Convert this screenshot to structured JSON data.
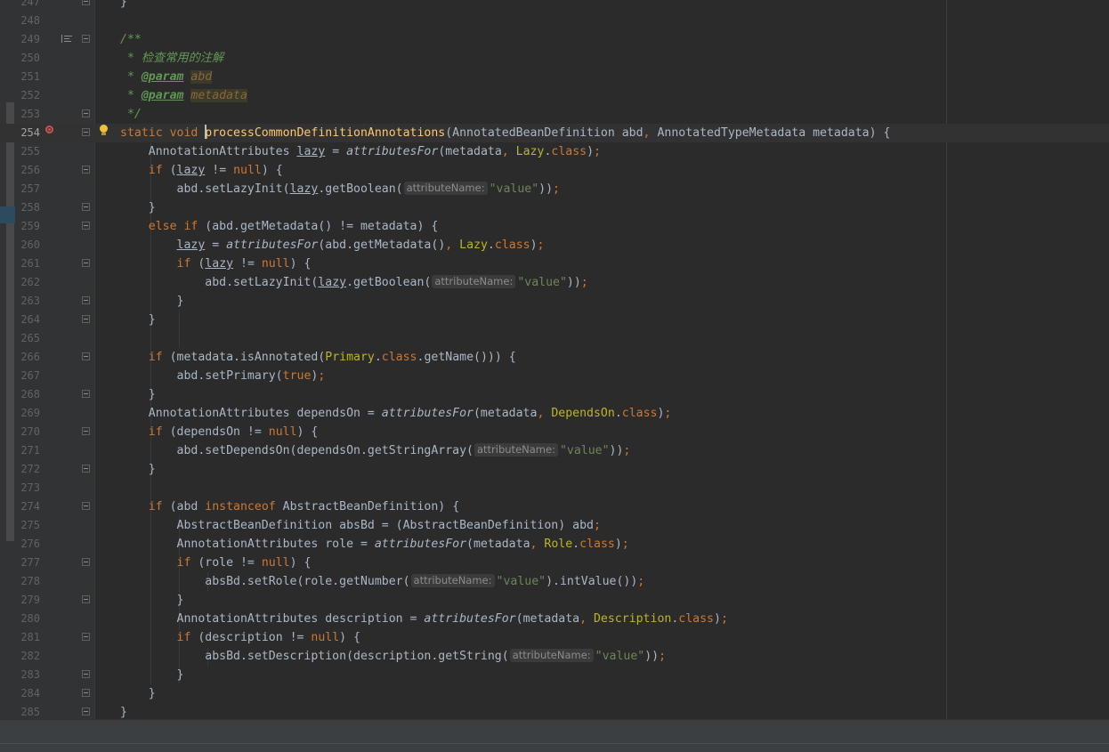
{
  "editor": {
    "lines": [
      {
        "num": "247",
        "tokens": [
          {
            "t": "}",
            "c": ""
          }
        ]
      },
      {
        "num": "248",
        "tokens": []
      },
      {
        "num": "249",
        "tokens": [
          {
            "t": "/**",
            "c": "doc"
          }
        ]
      },
      {
        "num": "250",
        "tokens": [
          {
            "t": " * 检查常用的注解",
            "c": "doc"
          }
        ]
      },
      {
        "num": "251",
        "tokens": [
          {
            "t": " * ",
            "c": "doc"
          },
          {
            "t": "@param",
            "c": "doctag"
          },
          {
            "t": " ",
            "c": "doc"
          },
          {
            "t": "abd",
            "c": "docval"
          }
        ]
      },
      {
        "num": "252",
        "tokens": [
          {
            "t": " * ",
            "c": "doc"
          },
          {
            "t": "@param",
            "c": "doctag"
          },
          {
            "t": " ",
            "c": "doc"
          },
          {
            "t": "metadata",
            "c": "docval"
          }
        ]
      },
      {
        "num": "253",
        "tokens": [
          {
            "t": " */",
            "c": "doc"
          }
        ]
      },
      {
        "num": "254",
        "tokens": [
          {
            "t": "static ",
            "c": "kw"
          },
          {
            "t": "void ",
            "c": "kw"
          },
          {
            "t": "",
            "c": "cursor"
          },
          {
            "t": "processCommonDefinitionAnnotations",
            "c": "fn"
          },
          {
            "t": "(AnnotatedBeanDefinition abd",
            "c": ""
          },
          {
            "t": ", ",
            "c": "kw"
          },
          {
            "t": "AnnotatedTypeMetadata metadata) {",
            "c": ""
          }
        ]
      },
      {
        "num": "255",
        "tokens": [
          {
            "t": "    AnnotationAttributes ",
            "c": ""
          },
          {
            "t": "lazy",
            "c": "ul"
          },
          {
            "t": " = ",
            "c": ""
          },
          {
            "t": "attributesFor",
            "c": "it"
          },
          {
            "t": "(metadata",
            "c": ""
          },
          {
            "t": ", ",
            "c": "kw"
          },
          {
            "t": "Lazy",
            "c": "ann"
          },
          {
            "t": ".",
            "c": ""
          },
          {
            "t": "class",
            "c": "kw"
          },
          {
            "t": ")",
            "c": ""
          },
          {
            "t": ";",
            "c": "kw"
          }
        ]
      },
      {
        "num": "256",
        "tokens": [
          {
            "t": "    ",
            "c": ""
          },
          {
            "t": "if ",
            "c": "kw"
          },
          {
            "t": "(",
            "c": ""
          },
          {
            "t": "lazy",
            "c": "ul"
          },
          {
            "t": " != ",
            "c": ""
          },
          {
            "t": "null",
            "c": "kw"
          },
          {
            "t": ") {",
            "c": ""
          }
        ]
      },
      {
        "num": "257",
        "tokens": [
          {
            "t": "        abd.setLazyInit(",
            "c": ""
          },
          {
            "t": "lazy",
            "c": "ul"
          },
          {
            "t": ".getBoolean(",
            "c": ""
          },
          {
            "t": "attributeName:",
            "c": "hint"
          },
          {
            "t": "\"value\"",
            "c": "str"
          },
          {
            "t": "))",
            "c": ""
          },
          {
            "t": ";",
            "c": "kw"
          }
        ]
      },
      {
        "num": "258",
        "tokens": [
          {
            "t": "    }",
            "c": ""
          }
        ]
      },
      {
        "num": "259",
        "tokens": [
          {
            "t": "    ",
            "c": ""
          },
          {
            "t": "else if ",
            "c": "kw"
          },
          {
            "t": "(abd.getMetadata() != metadata) {",
            "c": ""
          }
        ]
      },
      {
        "num": "260",
        "tokens": [
          {
            "t": "        ",
            "c": ""
          },
          {
            "t": "lazy",
            "c": "ul"
          },
          {
            "t": " = ",
            "c": ""
          },
          {
            "t": "attributesFor",
            "c": "it"
          },
          {
            "t": "(abd.getMetadata()",
            "c": ""
          },
          {
            "t": ", ",
            "c": "kw"
          },
          {
            "t": "Lazy",
            "c": "ann"
          },
          {
            "t": ".",
            "c": ""
          },
          {
            "t": "class",
            "c": "kw"
          },
          {
            "t": ")",
            "c": ""
          },
          {
            "t": ";",
            "c": "kw"
          }
        ]
      },
      {
        "num": "261",
        "tokens": [
          {
            "t": "        ",
            "c": ""
          },
          {
            "t": "if ",
            "c": "kw"
          },
          {
            "t": "(",
            "c": ""
          },
          {
            "t": "lazy",
            "c": "ul"
          },
          {
            "t": " != ",
            "c": ""
          },
          {
            "t": "null",
            "c": "kw"
          },
          {
            "t": ") {",
            "c": ""
          }
        ]
      },
      {
        "num": "262",
        "tokens": [
          {
            "t": "            abd.setLazyInit(",
            "c": ""
          },
          {
            "t": "lazy",
            "c": "ul"
          },
          {
            "t": ".getBoolean(",
            "c": ""
          },
          {
            "t": "attributeName:",
            "c": "hint"
          },
          {
            "t": "\"value\"",
            "c": "str"
          },
          {
            "t": "))",
            "c": ""
          },
          {
            "t": ";",
            "c": "kw"
          }
        ]
      },
      {
        "num": "263",
        "tokens": [
          {
            "t": "        }",
            "c": ""
          }
        ]
      },
      {
        "num": "264",
        "tokens": [
          {
            "t": "    }",
            "c": ""
          }
        ]
      },
      {
        "num": "265",
        "tokens": []
      },
      {
        "num": "266",
        "tokens": [
          {
            "t": "    ",
            "c": ""
          },
          {
            "t": "if ",
            "c": "kw"
          },
          {
            "t": "(metadata.isAnnotated(",
            "c": ""
          },
          {
            "t": "Primary",
            "c": "ann"
          },
          {
            "t": ".",
            "c": ""
          },
          {
            "t": "class",
            "c": "kw"
          },
          {
            "t": ".getName())) {",
            "c": ""
          }
        ]
      },
      {
        "num": "267",
        "tokens": [
          {
            "t": "        abd.setPrimary(",
            "c": ""
          },
          {
            "t": "true",
            "c": "kw"
          },
          {
            "t": ")",
            "c": ""
          },
          {
            "t": ";",
            "c": "kw"
          }
        ]
      },
      {
        "num": "268",
        "tokens": [
          {
            "t": "    }",
            "c": ""
          }
        ]
      },
      {
        "num": "269",
        "tokens": [
          {
            "t": "    AnnotationAttributes dependsOn = ",
            "c": ""
          },
          {
            "t": "attributesFor",
            "c": "it"
          },
          {
            "t": "(metadata",
            "c": ""
          },
          {
            "t": ", ",
            "c": "kw"
          },
          {
            "t": "DependsOn",
            "c": "ann"
          },
          {
            "t": ".",
            "c": ""
          },
          {
            "t": "class",
            "c": "kw"
          },
          {
            "t": ")",
            "c": ""
          },
          {
            "t": ";",
            "c": "kw"
          }
        ]
      },
      {
        "num": "270",
        "tokens": [
          {
            "t": "    ",
            "c": ""
          },
          {
            "t": "if ",
            "c": "kw"
          },
          {
            "t": "(dependsOn != ",
            "c": ""
          },
          {
            "t": "null",
            "c": "kw"
          },
          {
            "t": ") {",
            "c": ""
          }
        ]
      },
      {
        "num": "271",
        "tokens": [
          {
            "t": "        abd.setDependsOn(dependsOn.getStringArray(",
            "c": ""
          },
          {
            "t": "attributeName:",
            "c": "hint"
          },
          {
            "t": "\"value\"",
            "c": "str"
          },
          {
            "t": "))",
            "c": ""
          },
          {
            "t": ";",
            "c": "kw"
          }
        ]
      },
      {
        "num": "272",
        "tokens": [
          {
            "t": "    }",
            "c": ""
          }
        ]
      },
      {
        "num": "273",
        "tokens": []
      },
      {
        "num": "274",
        "tokens": [
          {
            "t": "    ",
            "c": ""
          },
          {
            "t": "if ",
            "c": "kw"
          },
          {
            "t": "(abd ",
            "c": ""
          },
          {
            "t": "instanceof ",
            "c": "kw"
          },
          {
            "t": "AbstractBeanDefinition) {",
            "c": ""
          }
        ]
      },
      {
        "num": "275",
        "tokens": [
          {
            "t": "        AbstractBeanDefinition absBd = (AbstractBeanDefinition) abd",
            "c": ""
          },
          {
            "t": ";",
            "c": "kw"
          }
        ]
      },
      {
        "num": "276",
        "tokens": [
          {
            "t": "        AnnotationAttributes role = ",
            "c": ""
          },
          {
            "t": "attributesFor",
            "c": "it"
          },
          {
            "t": "(metadata",
            "c": ""
          },
          {
            "t": ", ",
            "c": "kw"
          },
          {
            "t": "Role",
            "c": "ann"
          },
          {
            "t": ".",
            "c": ""
          },
          {
            "t": "class",
            "c": "kw"
          },
          {
            "t": ")",
            "c": ""
          },
          {
            "t": ";",
            "c": "kw"
          }
        ]
      },
      {
        "num": "277",
        "tokens": [
          {
            "t": "        ",
            "c": ""
          },
          {
            "t": "if ",
            "c": "kw"
          },
          {
            "t": "(role != ",
            "c": ""
          },
          {
            "t": "null",
            "c": "kw"
          },
          {
            "t": ") {",
            "c": ""
          }
        ]
      },
      {
        "num": "278",
        "tokens": [
          {
            "t": "            absBd.setRole(role.getNumber(",
            "c": ""
          },
          {
            "t": "attributeName:",
            "c": "hint"
          },
          {
            "t": "\"value\"",
            "c": "str"
          },
          {
            "t": ").intValue())",
            "c": ""
          },
          {
            "t": ";",
            "c": "kw"
          }
        ]
      },
      {
        "num": "279",
        "tokens": [
          {
            "t": "        }",
            "c": ""
          }
        ]
      },
      {
        "num": "280",
        "tokens": [
          {
            "t": "        AnnotationAttributes description = ",
            "c": ""
          },
          {
            "t": "attributesFor",
            "c": "it"
          },
          {
            "t": "(metadata",
            "c": ""
          },
          {
            "t": ", ",
            "c": "kw"
          },
          {
            "t": "Description",
            "c": "ann"
          },
          {
            "t": ".",
            "c": ""
          },
          {
            "t": "class",
            "c": "kw"
          },
          {
            "t": ")",
            "c": ""
          },
          {
            "t": ";",
            "c": "kw"
          }
        ]
      },
      {
        "num": "281",
        "tokens": [
          {
            "t": "        ",
            "c": ""
          },
          {
            "t": "if ",
            "c": "kw"
          },
          {
            "t": "(description != ",
            "c": ""
          },
          {
            "t": "null",
            "c": "kw"
          },
          {
            "t": ") {",
            "c": ""
          }
        ]
      },
      {
        "num": "282",
        "tokens": [
          {
            "t": "            absBd.setDescription(description.getString(",
            "c": ""
          },
          {
            "t": "attributeName:",
            "c": "hint"
          },
          {
            "t": "\"value\"",
            "c": "str"
          },
          {
            "t": "))",
            "c": ""
          },
          {
            "t": ";",
            "c": "kw"
          }
        ]
      },
      {
        "num": "283",
        "tokens": [
          {
            "t": "        }",
            "c": ""
          }
        ]
      },
      {
        "num": "284",
        "tokens": [
          {
            "t": "    }",
            "c": ""
          }
        ]
      },
      {
        "num": "285",
        "tokens": [
          {
            "t": "}",
            "c": ""
          }
        ]
      }
    ],
    "fold_markers": [
      "247",
      "249",
      "253",
      "254",
      "256",
      "258",
      "259",
      "261",
      "263",
      "264",
      "266",
      "268",
      "270",
      "272",
      "274",
      "277",
      "279",
      "281",
      "283",
      "284",
      "285"
    ],
    "current_line": "254",
    "colors": {
      "background": "#2b2b2b",
      "gutter": "#313335",
      "keyword": "#cc7832",
      "method_decl": "#ffc66d",
      "annotation_class": "#bbb529",
      "string": "#6a8759",
      "doc_comment": "#629755",
      "text": "#a9b7c6"
    },
    "gutter_icons": {
      "implemented": "implemented-icon",
      "breakpoint": "breakpoint-icon",
      "intention": "lightbulb-icon"
    }
  }
}
